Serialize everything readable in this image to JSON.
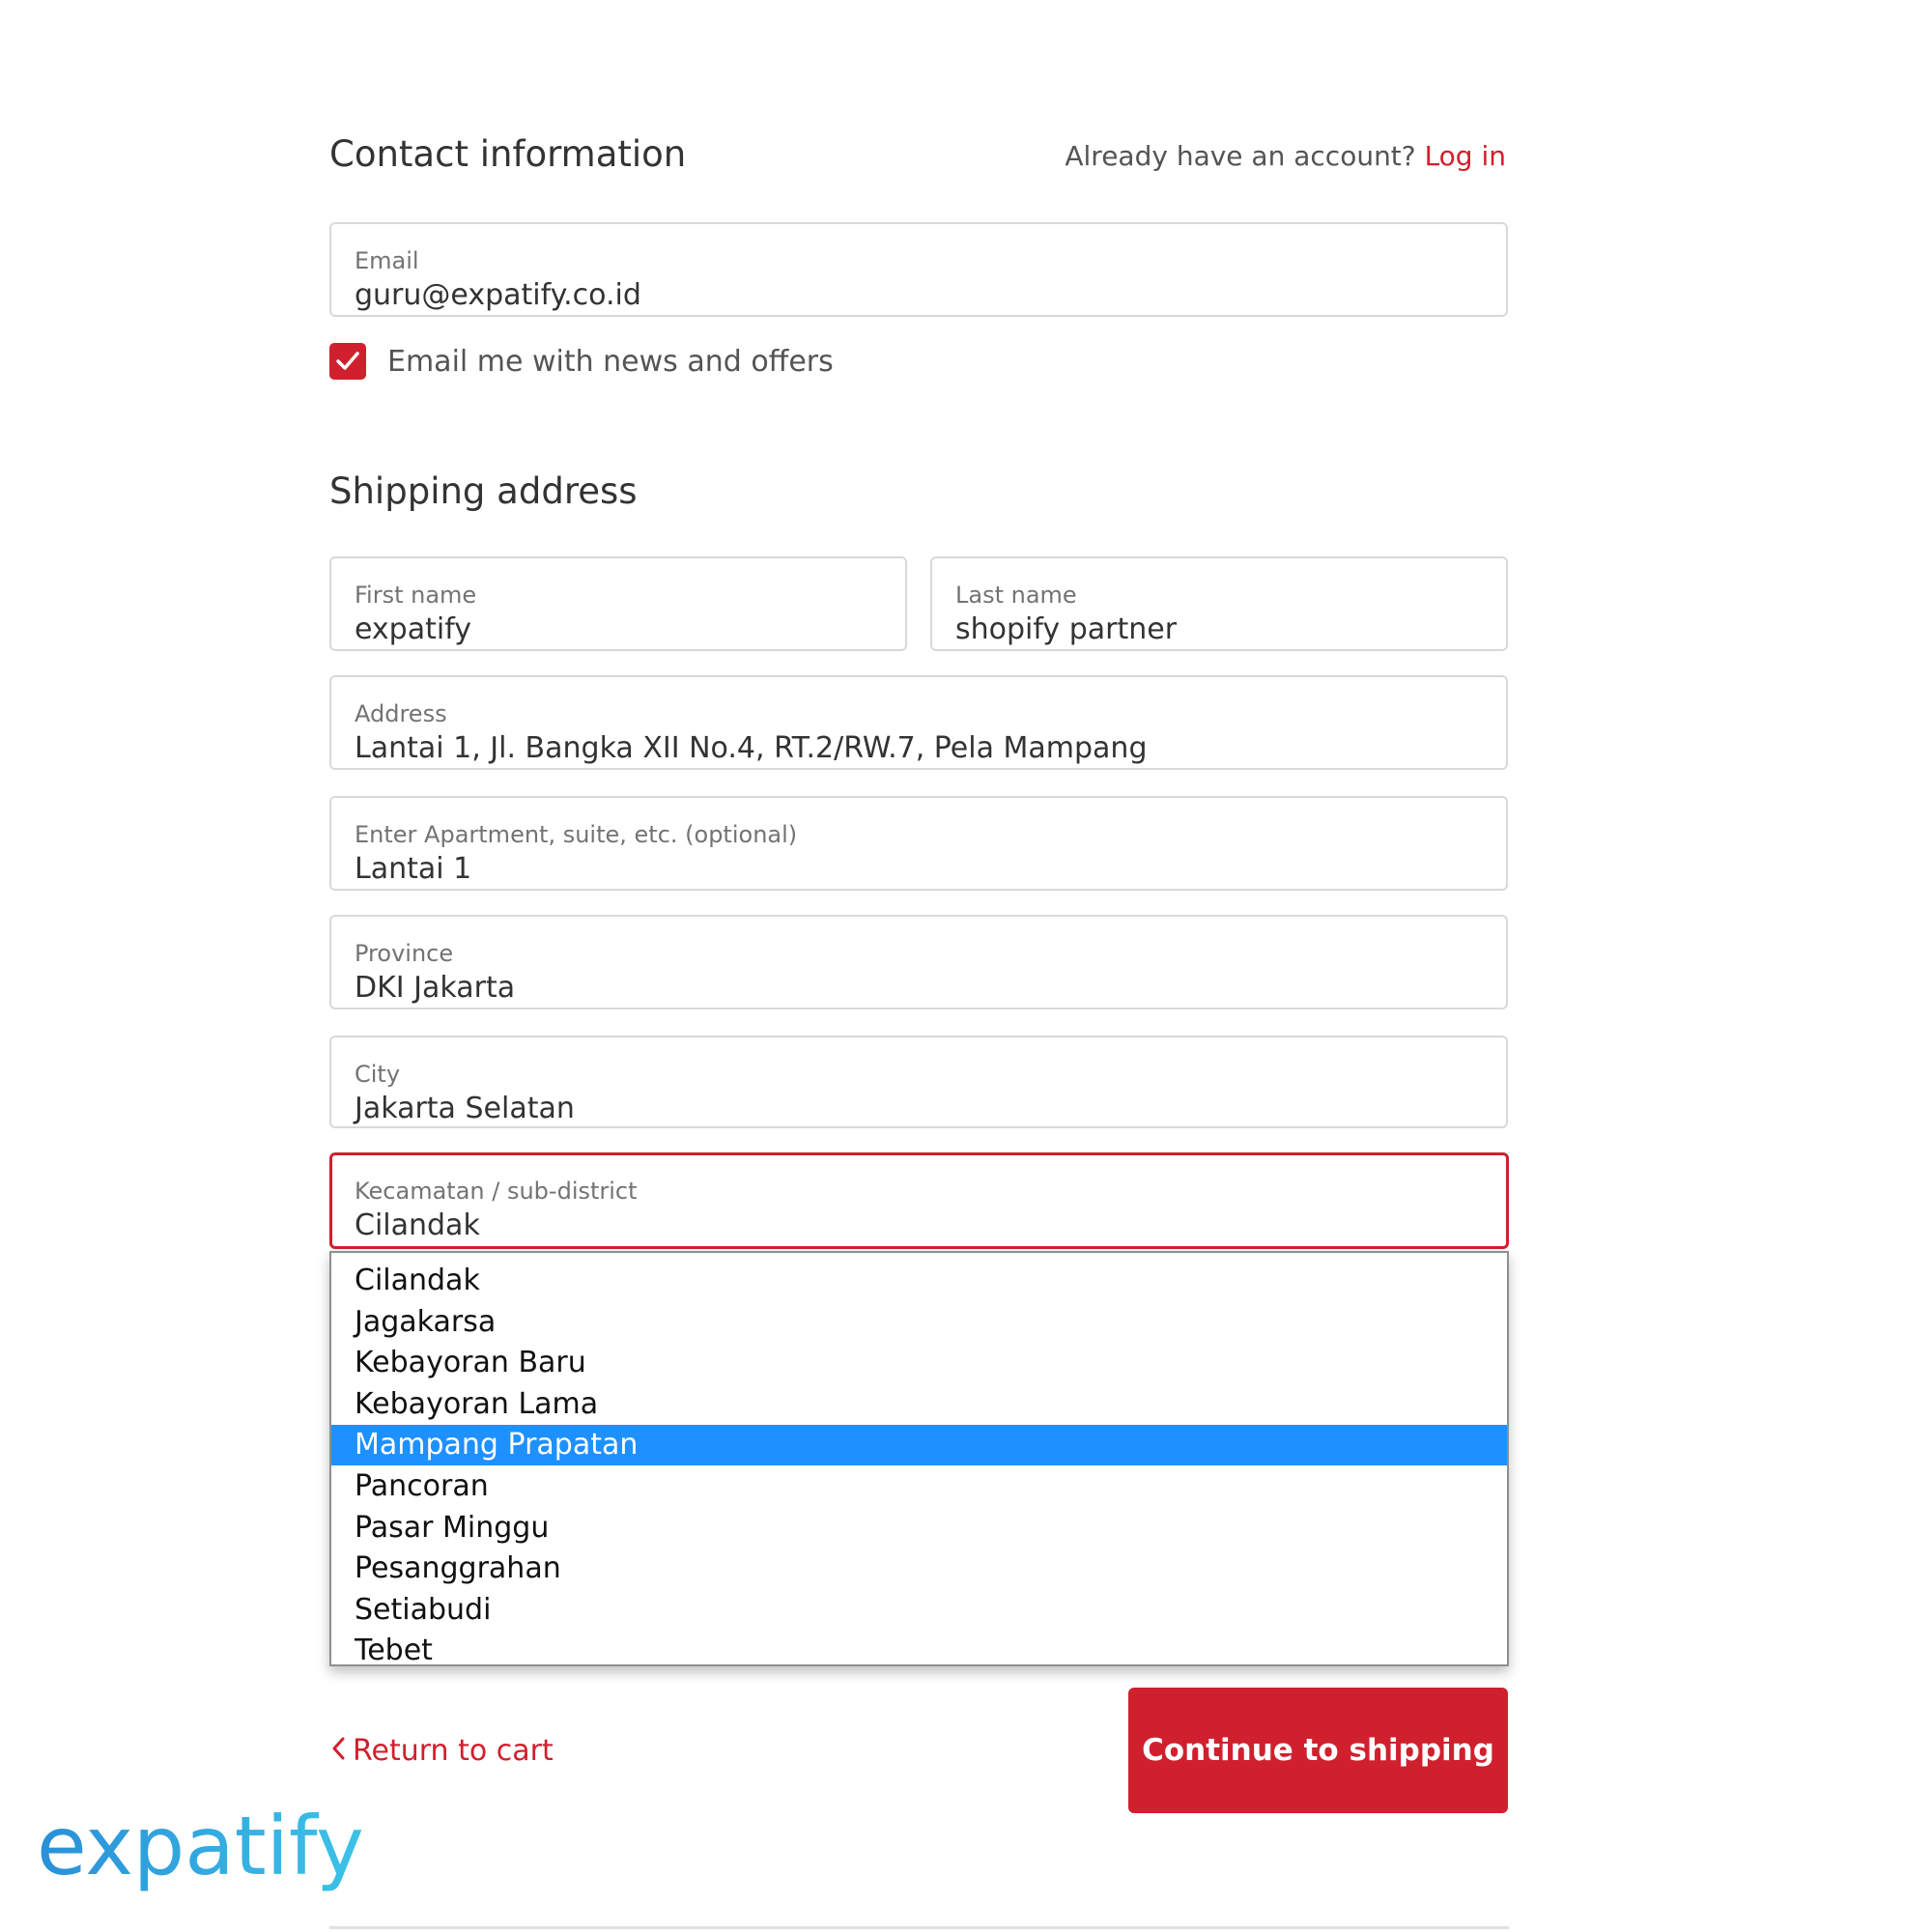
{
  "contact": {
    "heading": "Contact information",
    "account_prompt": "Already have an account?",
    "login_link": "Log in",
    "email_label": "Email",
    "email_value": "guru@expatify.co.id",
    "newsletter_label": "Email me with news and offers",
    "newsletter_checked": true
  },
  "shipping": {
    "heading": "Shipping address",
    "first_name_label": "First name",
    "first_name_value": "expatify",
    "last_name_label": "Last name",
    "last_name_value": "shopify partner",
    "address_label": "Address",
    "address_value": "Lantai 1, Jl. Bangka XII No.4, RT.2/RW.7, Pela Mampang",
    "apartment_label": "Enter Apartment, suite, etc. (optional)",
    "apartment_value": "Lantai 1",
    "province_label": "Province",
    "province_value": "DKI Jakarta",
    "city_label": "City",
    "city_value": "Jakarta Selatan",
    "subdistrict_label": "Kecamatan / sub-district",
    "subdistrict_value": "Cilandak"
  },
  "subdistrict_options": [
    {
      "label": "Cilandak",
      "highlighted": false
    },
    {
      "label": "Jagakarsa",
      "highlighted": false
    },
    {
      "label": "Kebayoran Baru",
      "highlighted": false
    },
    {
      "label": "Kebayoran Lama",
      "highlighted": false
    },
    {
      "label": "Mampang Prapatan",
      "highlighted": true
    },
    {
      "label": "Pancoran",
      "highlighted": false
    },
    {
      "label": "Pasar Minggu",
      "highlighted": false
    },
    {
      "label": "Pesanggrahan",
      "highlighted": false
    },
    {
      "label": "Setiabudi",
      "highlighted": false
    },
    {
      "label": "Tebet",
      "highlighted": false
    }
  ],
  "footer": {
    "return_link": "Return to cart",
    "continue_button": "Continue to shipping"
  },
  "brand": {
    "logo_text": "expatify",
    "accent_color": "#d0202e",
    "highlight_color": "#1e90ff",
    "logo_color_start": "#2a8fd8",
    "logo_color_end": "#3cc3e8"
  },
  "icons": {
    "checkbox": "checkmark-icon",
    "return": "chevron-left-icon"
  }
}
